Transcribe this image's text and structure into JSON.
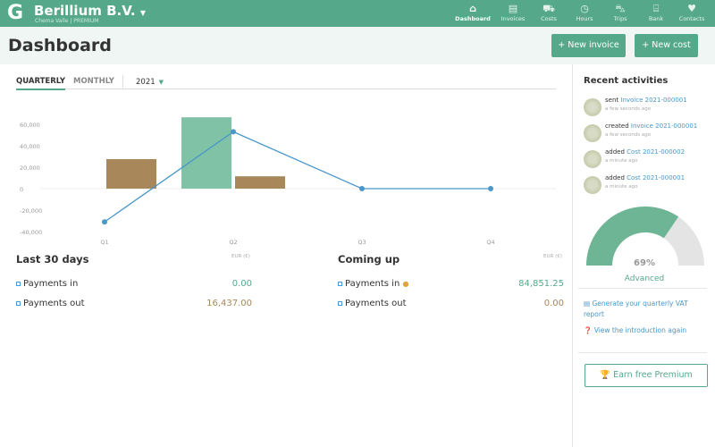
{
  "topbar": {
    "company": "Berillium B.V.",
    "subtitle": "Chema Valle | PREMIUM",
    "nav": [
      {
        "label": "Dashboard",
        "icon": "home-icon"
      },
      {
        "label": "Invoices",
        "icon": "file-icon"
      },
      {
        "label": "Costs",
        "icon": "cart-icon"
      },
      {
        "label": "Hours",
        "icon": "clock-icon"
      },
      {
        "label": "Trips",
        "icon": "car-icon"
      },
      {
        "label": "Bank",
        "icon": "bank-icon"
      },
      {
        "label": "Contacts",
        "icon": "heart-icon"
      }
    ]
  },
  "header": {
    "title": "Dashboard",
    "new_invoice": "+ New invoice",
    "new_cost": "+ New cost"
  },
  "tabs": {
    "quarterly": "QUARTERLY",
    "monthly": "MONTHLY",
    "year": "2021"
  },
  "colors": {
    "accent": "#55a98a",
    "income": "#7fc2a6",
    "cost": "#a8875a",
    "line": "#4a97c9"
  },
  "chart_data": {
    "type": "bar",
    "categories": [
      "Q1",
      "Q2",
      "Q3",
      "Q4"
    ],
    "yticks": [
      "60,000",
      "40,000",
      "20,000",
      "0",
      "-20,000",
      "-40,000"
    ],
    "ylim": [
      -40000,
      60000
    ],
    "series": [
      {
        "values": [
          0,
          66500,
          0,
          0
        ],
        "color": "#7fc2a6"
      },
      {
        "values": [
          27500,
          11500,
          0,
          0
        ],
        "color": "#a8875a"
      },
      {
        "type": "line",
        "values": [
          -31000,
          53000,
          0,
          0
        ],
        "color": "#4a97c9"
      }
    ]
  },
  "last30": {
    "title": "Last 30 days",
    "unit": "EUR (€)",
    "rows": [
      {
        "label": "Payments in",
        "value": "0.00"
      },
      {
        "label": "Payments out",
        "value": "16,437.00"
      }
    ]
  },
  "coming": {
    "title": "Coming up",
    "unit": "EUR (€)",
    "rows": [
      {
        "label": "Payments in",
        "value": "84,851.25"
      },
      {
        "label": "Payments out",
        "value": "0.00"
      }
    ]
  },
  "sidebar": {
    "title": "Recent activities",
    "activities": [
      {
        "verb": "sent",
        "link": "Invoice 2021-000001",
        "time": "a few seconds ago"
      },
      {
        "verb": "created",
        "link": "Invoice 2021-000001",
        "time": "a few seconds ago"
      },
      {
        "verb": "added",
        "link": "Cost 2021-000002",
        "time": "a minute ago"
      },
      {
        "verb": "added",
        "link": "Cost 2021-000001",
        "time": "a minute ago"
      }
    ],
    "progress": 69,
    "progress_label": "69%",
    "level": "Advanced",
    "vat_link": "Generate your quarterly VAT report",
    "intro_link": "View the introduction again",
    "premium_button": "Earn free Premium"
  }
}
